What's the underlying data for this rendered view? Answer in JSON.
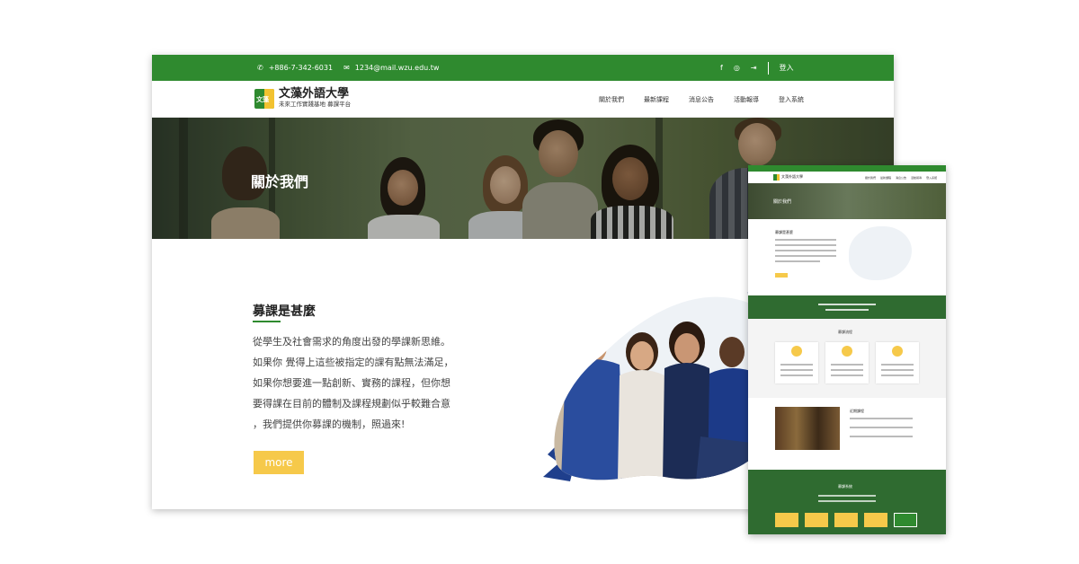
{
  "colors": {
    "brand_green": "#2f8a2f",
    "accent_yellow": "#f6c94a",
    "dark_green": "#2f6b30"
  },
  "topbar": {
    "phone_icon": "phone-icon",
    "phone": "+886-7-342-6031",
    "mail_icon": "mail-icon",
    "email": "1234@mail.wzu.edu.tw",
    "social_icons": [
      "facebook-icon",
      "instagram-icon",
      "login-icon"
    ],
    "login_label": "登入"
  },
  "header": {
    "logo_mark": "文藻",
    "site_name": "文藻外語大學",
    "tagline": "未來工作實踐基地 募課平台",
    "menu": [
      "關於我們",
      "最新課程",
      "消息公告",
      "活動報導",
      "登入系統"
    ]
  },
  "hero": {
    "title": "關於我們"
  },
  "about": {
    "heading": "募課是甚麼",
    "lines": [
      "從學生及社會需求的角度出發的學課新思維。",
      "如果你 覺得上這些被指定的課有點無法滿足，",
      "如果你想要進一點創新、實務的課程，但你想",
      "要得課在目前的體制及課程規劃似乎較難合意",
      "，我們提供你募課的機制，照過來!"
    ],
    "more_label": "more"
  },
  "mobile": {
    "hero_title": "關於我們",
    "about_heading": "募課是甚麼",
    "process_heading": "募課流程",
    "news_heading": "近期課程",
    "footer_heading": "募課系統"
  }
}
